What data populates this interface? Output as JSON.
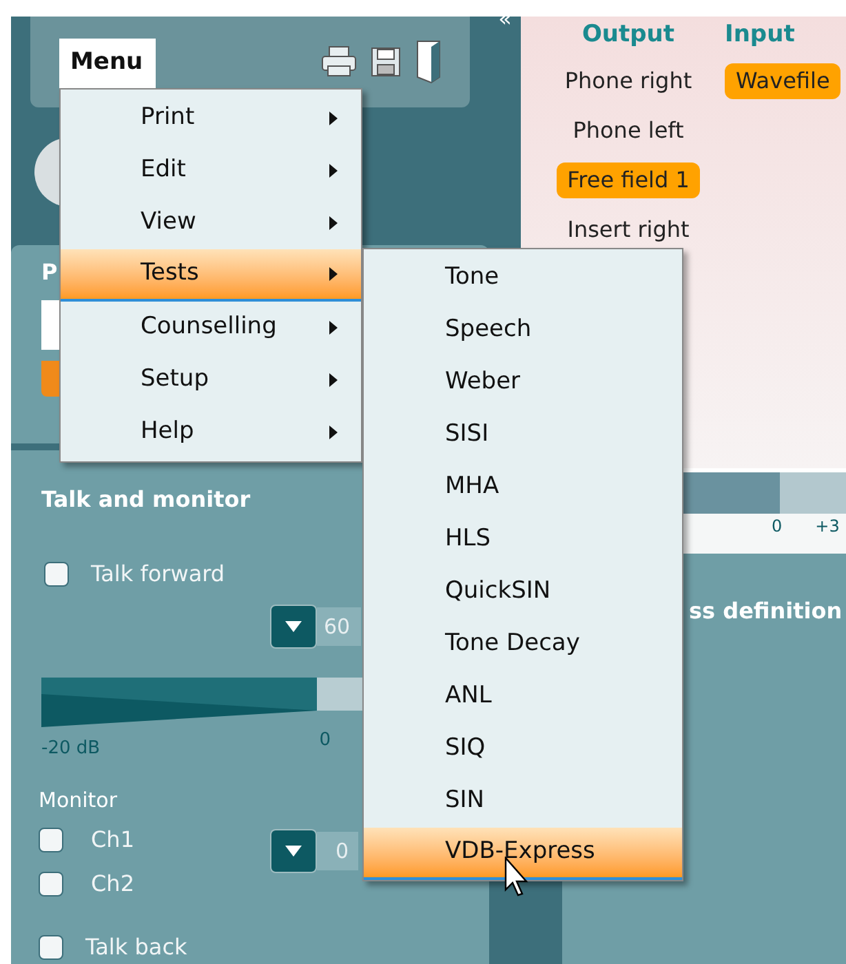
{
  "toolbar": {
    "menu_button": "Menu",
    "collapse_button": "«"
  },
  "left_panel": {
    "heading": "P"
  },
  "routing": {
    "output_heading": "Output",
    "input_heading": "Input",
    "outputs": [
      {
        "label": "Phone right",
        "selected": false
      },
      {
        "label": "Phone left",
        "selected": false
      },
      {
        "label": "Free field 1",
        "selected": true
      },
      {
        "label": "Insert right",
        "selected": false
      }
    ],
    "inputs": [
      {
        "label": "Wavefile",
        "selected": true
      }
    ],
    "scale_labels": [
      "0",
      "+3"
    ]
  },
  "section_heading": "ss definition",
  "talk_monitor": {
    "title": "Talk and monitor",
    "talk_forward": {
      "label": "Talk forward",
      "checked": false
    },
    "talk_forward_value": "60",
    "meter_min_label": "-20 dB",
    "meter_zero_label": "0",
    "monitor_label": "Monitor",
    "channels": [
      {
        "label": "Ch1",
        "checked": false
      },
      {
        "label": "Ch2",
        "checked": false
      }
    ],
    "monitor_value": "0",
    "talk_back": {
      "label": "Talk back",
      "checked": false
    }
  },
  "menu": [
    {
      "label": "Print",
      "selected": false
    },
    {
      "label": "Edit",
      "selected": false
    },
    {
      "label": "View",
      "selected": false
    },
    {
      "label": "Tests",
      "selected": true
    },
    {
      "label": "Counselling",
      "selected": false
    },
    {
      "label": "Setup",
      "selected": false
    },
    {
      "label": "Help",
      "selected": false
    }
  ],
  "tests_submenu": [
    {
      "label": "Tone",
      "selected": false
    },
    {
      "label": "Speech",
      "selected": false
    },
    {
      "label": "Weber",
      "selected": false
    },
    {
      "label": "SISI",
      "selected": false
    },
    {
      "label": "MHA",
      "selected": false
    },
    {
      "label": "HLS",
      "selected": false
    },
    {
      "label": "QuickSIN",
      "selected": false
    },
    {
      "label": "Tone Decay",
      "selected": false
    },
    {
      "label": "ANL",
      "selected": false
    },
    {
      "label": "SIQ",
      "selected": false
    },
    {
      "label": "SIN",
      "selected": false
    },
    {
      "label": "VDB-Express",
      "selected": true
    }
  ]
}
